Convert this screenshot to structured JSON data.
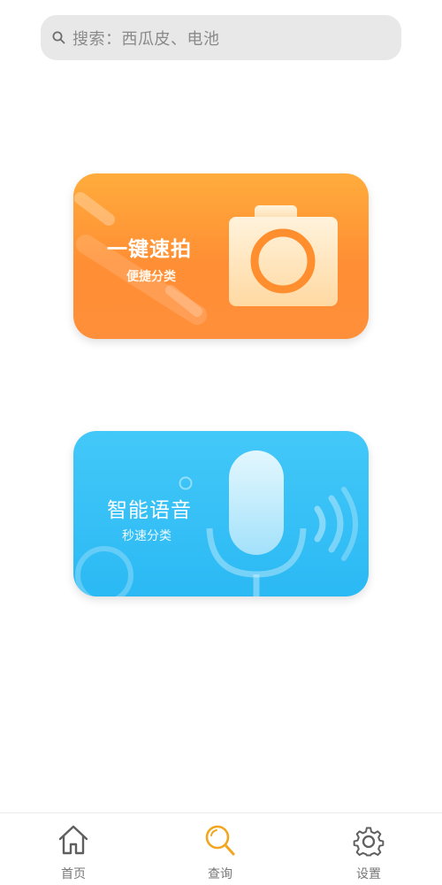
{
  "search": {
    "placeholder": "搜索：西瓜皮、电池",
    "icon": "search-icon"
  },
  "cards": [
    {
      "title": "一键速拍",
      "subtitle": "便捷分类",
      "icon": "camera-icon",
      "color": "#ff9a38"
    },
    {
      "title": "智能语音",
      "subtitle": "秒速分类",
      "icon": "microphone-icon",
      "color": "#36c0f6"
    }
  ],
  "tabs": [
    {
      "label": "首页",
      "icon": "home-icon",
      "active": false
    },
    {
      "label": "查询",
      "icon": "search-icon",
      "active": true,
      "color": "#f2a51e"
    },
    {
      "label": "设置",
      "icon": "gear-icon",
      "active": false
    }
  ]
}
